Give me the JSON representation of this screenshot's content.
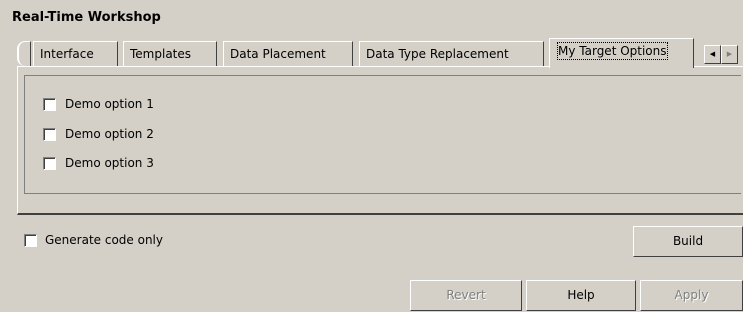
{
  "panel": {
    "title": "Real-Time Workshop"
  },
  "tabs": [
    {
      "label": "Interface"
    },
    {
      "label": "Templates"
    },
    {
      "label": "Data Placement"
    },
    {
      "label": "Data Type Replacement"
    },
    {
      "label": "My Target Options",
      "active": true
    }
  ],
  "tab_scroll": {
    "left_icon": "arrow-left-icon",
    "right_icon": "arrow-right-icon"
  },
  "options": [
    {
      "label": "Demo option 1",
      "checked": false
    },
    {
      "label": "Demo option 2",
      "checked": false
    },
    {
      "label": "Demo option 3",
      "checked": false
    }
  ],
  "generate_code_only": {
    "label": "Generate code only",
    "checked": false
  },
  "buttons": {
    "build": "Build",
    "revert": "Revert",
    "help": "Help",
    "apply": "Apply"
  },
  "colors": {
    "background": "#d4d0c8",
    "disabled_text": "#808080"
  }
}
